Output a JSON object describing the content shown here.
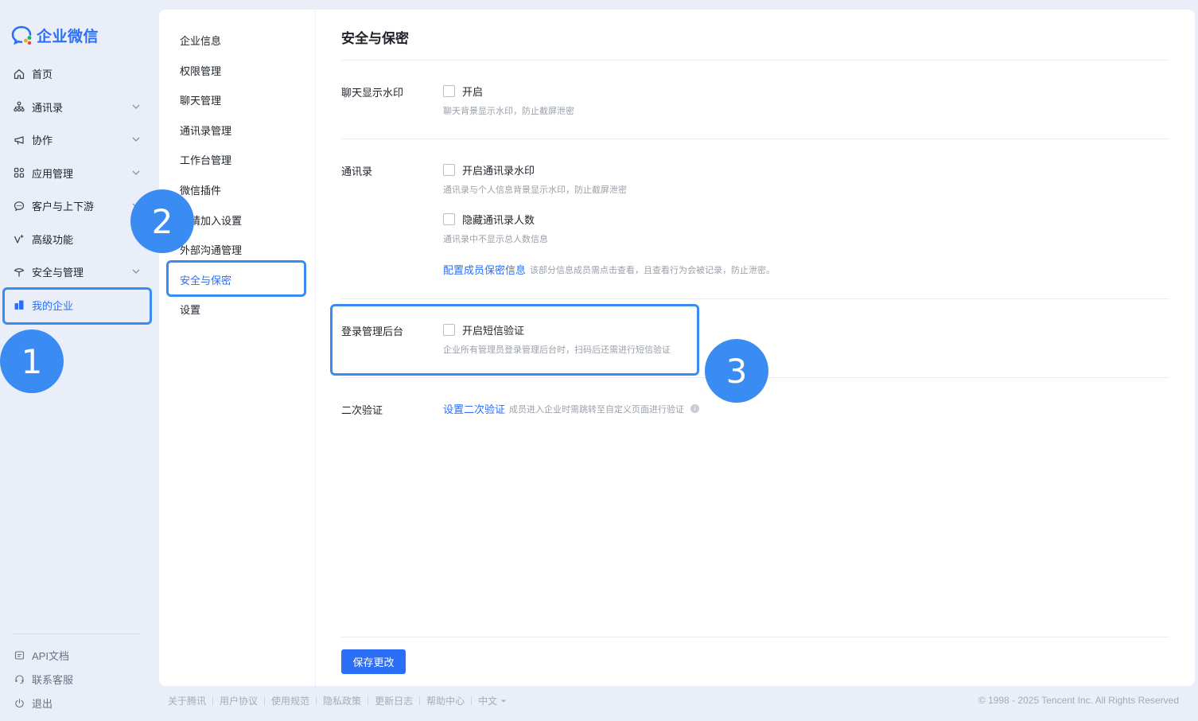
{
  "app": {
    "logo_text": "企业微信"
  },
  "sidebar": {
    "items": [
      {
        "label": "首页",
        "icon": "home-icon",
        "has_chevron": false
      },
      {
        "label": "通讯录",
        "icon": "org-chart-icon",
        "has_chevron": true
      },
      {
        "label": "协作",
        "icon": "collab-icon",
        "has_chevron": true
      },
      {
        "label": "应用管理",
        "icon": "apps-grid-icon",
        "has_chevron": true
      },
      {
        "label": "客户与上下游",
        "icon": "chat-bubble-icon",
        "has_chevron": true
      },
      {
        "label": "高级功能",
        "icon": "sparkle-icon",
        "has_chevron": false
      },
      {
        "label": "安全与管理",
        "icon": "shield-icon",
        "has_chevron": true
      },
      {
        "label": "我的企业",
        "icon": "building-icon",
        "has_chevron": false,
        "active": true
      }
    ],
    "bottom": [
      {
        "label": "API文档",
        "icon": "doc-icon"
      },
      {
        "label": "联系客服",
        "icon": "headset-icon"
      },
      {
        "label": "退出",
        "icon": "power-icon"
      }
    ]
  },
  "subnav": {
    "items": [
      {
        "label": "企业信息"
      },
      {
        "label": "权限管理"
      },
      {
        "label": "聊天管理"
      },
      {
        "label": "通讯录管理"
      },
      {
        "label": "工作台管理"
      },
      {
        "label": "微信插件"
      },
      {
        "label": "邀请加入设置"
      },
      {
        "label": "外部沟通管理"
      },
      {
        "label": "安全与保密",
        "active": true
      },
      {
        "label": "设置"
      }
    ]
  },
  "main": {
    "title": "安全与保密",
    "chat_watermark": {
      "label": "聊天显示水印",
      "option": "开启",
      "hint": "聊天背景显示水印，防止截屏泄密"
    },
    "contacts": {
      "label": "通讯录",
      "watermark_option": "开启通讯录水印",
      "watermark_hint": "通讯录与个人信息背景显示水印，防止截屏泄密",
      "hide_count_option": "隐藏通讯录人数",
      "hide_count_hint": "通讯录中不显示总人数信息",
      "config_link": "配置成员保密信息",
      "config_hint": "该部分信息成员需点击查看，且查看行为会被记录，防止泄密。"
    },
    "admin_login": {
      "label": "登录管理后台",
      "option": "开启短信验证",
      "hint": "企业所有管理员登录管理后台时，扫码后还需进行短信验证"
    },
    "second_verify": {
      "label": "二次验证",
      "link": "设置二次验证",
      "hint": "成员进入企业时需跳转至自定义页面进行验证"
    },
    "save_label": "保存更改"
  },
  "footer": {
    "links": [
      "关于腾讯",
      "用户协议",
      "使用规范",
      "隐私政策",
      "更新日志",
      "帮助中心",
      "中文"
    ],
    "copyright": "© 1998 - 2025 Tencent Inc. All Rights Reserved"
  },
  "callouts": [
    "1",
    "2",
    "3"
  ],
  "colors": {
    "accent": "#2b6ff6",
    "callout": "#3b8cf2",
    "background": "#e9eef8"
  }
}
